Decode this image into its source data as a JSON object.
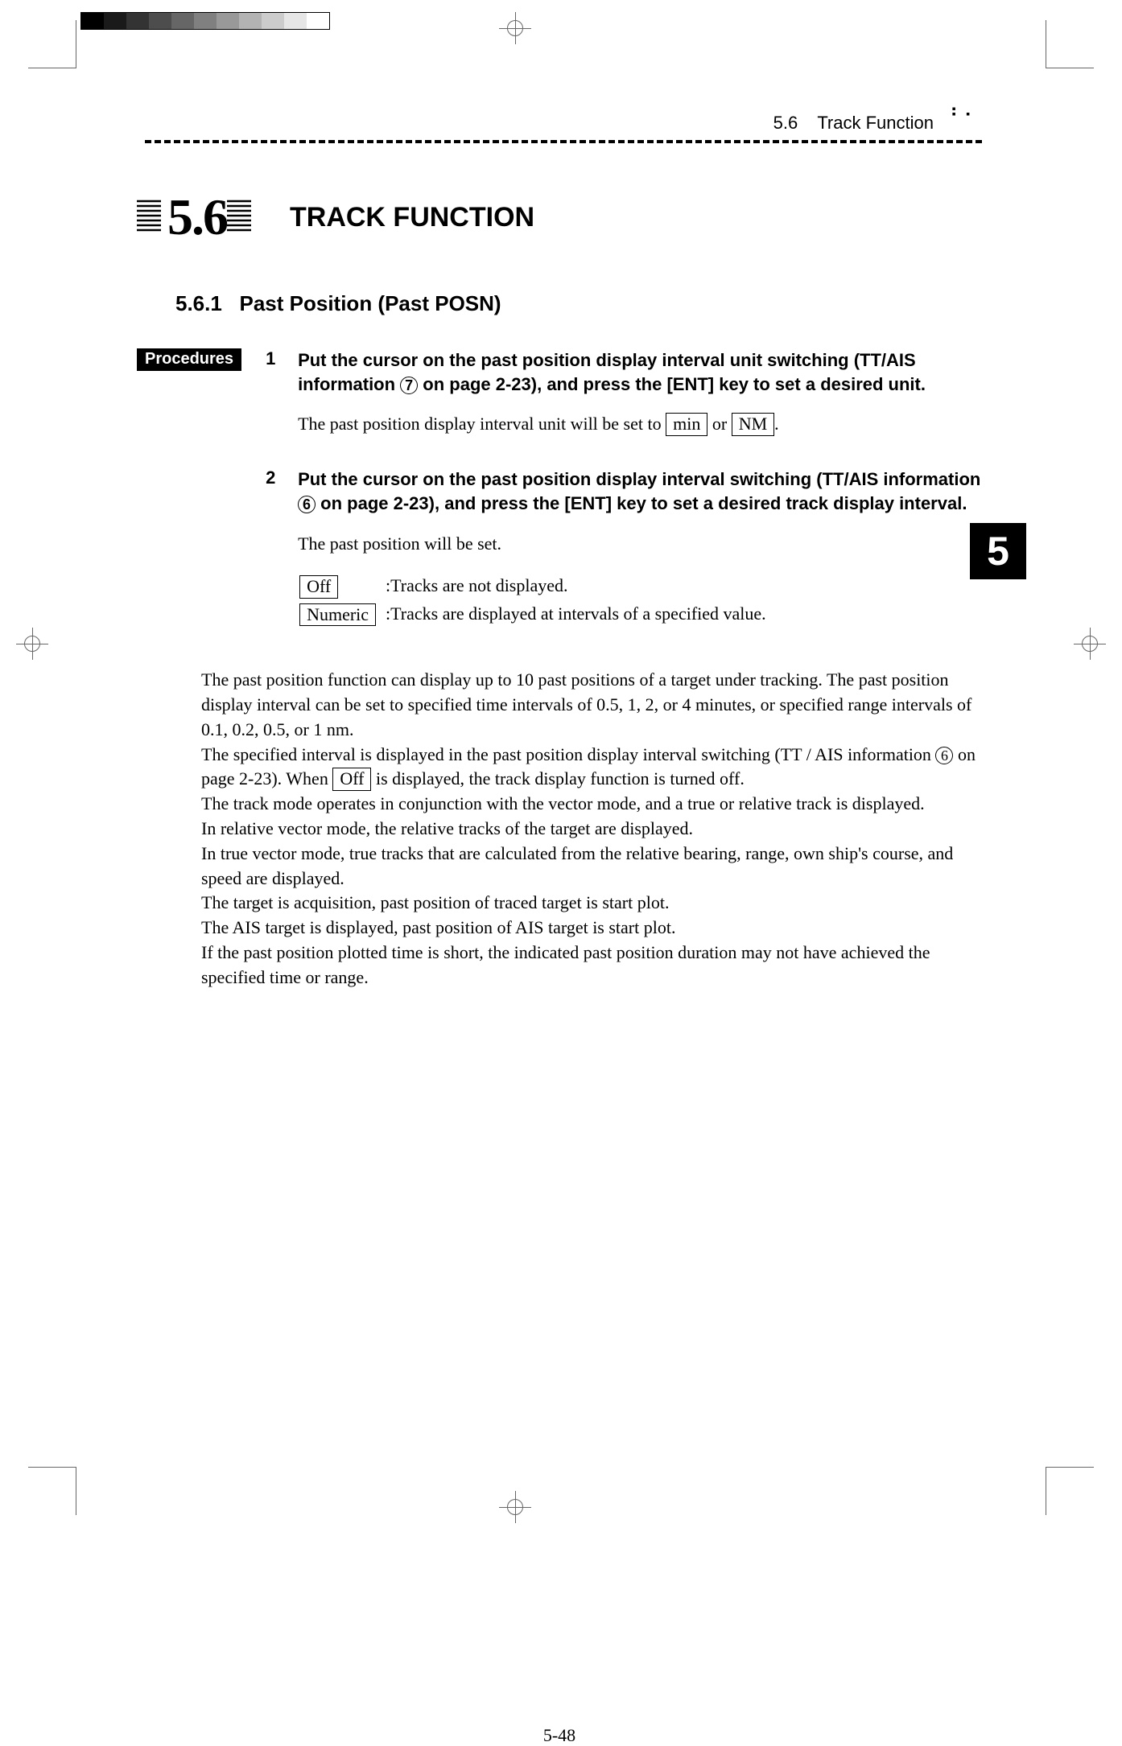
{
  "header": {
    "section_ref": "5.6",
    "section_name": "Track Function"
  },
  "side_tab": "5",
  "section": {
    "number": "5.6",
    "title": "TRACK FUNCTION"
  },
  "subsection": {
    "number": "5.6.1",
    "title": "Past Position (Past POSN)"
  },
  "procedures_label": "Procedures",
  "steps": {
    "s1": {
      "num": "1",
      "instruction_1": "Put the cursor on the past position display interval unit switching (TT/AIS information ",
      "circled": "7",
      "instruction_2": " on page 2-23), and press the [ENT] key to set a desired unit.",
      "detail_1": "The past position display interval unit will be set to ",
      "key1": "min",
      "detail_or": " or ",
      "key2": "NM",
      "detail_period": "."
    },
    "s2": {
      "num": "2",
      "instruction_1": "Put the cursor on the past position display interval switching (TT/AIS information ",
      "circled": "6",
      "instruction_2": " on page 2-23), and press the [ENT] key to set a desired track display interval.",
      "detail": "The past position will be set.",
      "opt1_key": "Off",
      "opt1_desc": ":Tracks are not displayed.",
      "opt2_key": "Numeric",
      "opt2_desc": ":Tracks are displayed at intervals of a specified value."
    }
  },
  "body": {
    "p1": "The past position function can display up to 10 past positions of a target under tracking.    The past position display interval can be set to specified time intervals of 0.5, 1, 2, or 4 minutes, or specified range intervals of 0.1, 0.2, 0.5, or 1 nm.",
    "p2a": "The specified interval is displayed in the past position display interval switching (TT / AIS information ",
    "p2_circled": "6",
    "p2b": " on page 2-23).    When ",
    "p2_key": "Off",
    "p2c": " is displayed, the track display function is turned off.",
    "p3": "The track mode operates in conjunction with the vector mode, and a true or relative track is displayed.",
    "p4": "In relative vector mode, the relative tracks of the target are displayed.",
    "p5": "In true vector mode, true tracks that are calculated from the relative bearing, range, own ship's course, and speed are displayed.",
    "p6": "The target is acquisition, past position of traced target is start plot.",
    "p7": "The AIS target is displayed, past position of AIS target is start plot.",
    "p8": "If the past position plotted time is short, the indicated past position duration may not have achieved the specified time or range."
  },
  "page_number": "5-48"
}
